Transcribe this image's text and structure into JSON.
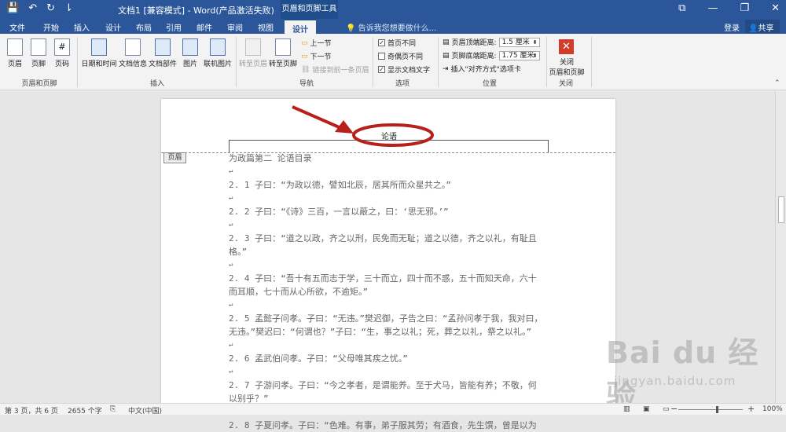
{
  "titlebar": {
    "title": "文档1 [兼容模式] - Word(产品激活失败)",
    "context_tab": "页眉和页脚工具",
    "qat": {
      "save": "💾",
      "undo": "↶",
      "redo": "↻",
      "more": "⇂"
    },
    "win": {
      "ribbon_options": "⧉",
      "minimize": "—",
      "restore": "❐",
      "close": "✕"
    }
  },
  "tabs": [
    "文件",
    "开始",
    "插入",
    "设计",
    "布局",
    "引用",
    "邮件",
    "审阅",
    "视图",
    "设计"
  ],
  "tellme": "告诉我您想要做什么...",
  "signin": "登录",
  "share": "共享",
  "ribbon": {
    "header_footer": {
      "header": "页眉",
      "footer": "页脚",
      "page_number": "页码",
      "group": "页眉和页脚"
    },
    "insert": {
      "datetime": "日期和时间",
      "docinfo": "文档信息",
      "quickparts": "文档部件",
      "picture": "图片",
      "online_picture": "联机图片",
      "group": "插入"
    },
    "nav": {
      "goto_header": "转至页眉",
      "goto_footer": "转至页脚",
      "prev": "上一节",
      "next": "下一节",
      "link_prev": "链接到前一条页眉",
      "group": "导航"
    },
    "options": {
      "diff_first": "首页不同",
      "diff_odd_even": "奇偶页不同",
      "show_text": "显示文档文字",
      "group": "选项"
    },
    "position": {
      "header_top": "页眉顶端距离:",
      "header_top_val": "1.5 厘米",
      "footer_bottom": "页脚底端距离:",
      "footer_bottom_val": "1.75 厘米",
      "insert_tab": "插入\"对齐方式\"选项卡",
      "group": "位置"
    },
    "close": {
      "label1": "关闭",
      "label2": "页眉和页脚",
      "group": "关闭"
    }
  },
  "document": {
    "header_text": "论语",
    "header_tag": "页眉",
    "lines": [
      "为政篇第二 论语目录",
      "↵",
      "2. 1 子曰：“为政以德，譬如北辰，居其所而众星共之。”",
      "↵",
      "2. 2 子曰：“《诗》三百，一言以蔽之，曰：‘思无邪。’”",
      "↵",
      "2. 3 子曰：“道之以政，齐之以刑，民免而无耻；道之以德，齐之以礼，有耻且",
      "格。”",
      "↵",
      "2. 4 子曰：“吾十有五而志于学，三十而立，四十而不惑，五十而知天命，六十",
      "而耳顺，七十而从心所欲，不逾矩。”",
      "↵",
      "2. 5 孟懿子问孝。子曰：“无违。”樊迟御，子告之曰：“孟孙问孝于我，我对曰，",
      "无违。”樊迟曰：“何谓也？”子曰：“生，事之以礼；死，葬之以礼，祭之以礼。”",
      "↵",
      "2. 6 孟武伯问孝。子曰：“父母唯其疾之忧。”",
      "↵",
      "2. 7 子游问孝。子曰：“今之孝者，是谓能养。至于犬马，皆能有养；不敬，何",
      "以别乎？”",
      "↵",
      "2. 8 子夏问孝。子曰：“色难。有事，弟子服其劳；有酒食，先生馔，曾是以为"
    ]
  },
  "status": {
    "page": "第 3 页，共 6 页",
    "words": "2655 个字",
    "lang": "中文(中国)",
    "zoom": "100%",
    "minus": "−",
    "plus": "+"
  },
  "watermark": {
    "logo": "Bai du 经验",
    "url": "jingyan.baidu.com"
  },
  "colors": {
    "accent": "#2b579a",
    "annotation": "#b8211b"
  }
}
